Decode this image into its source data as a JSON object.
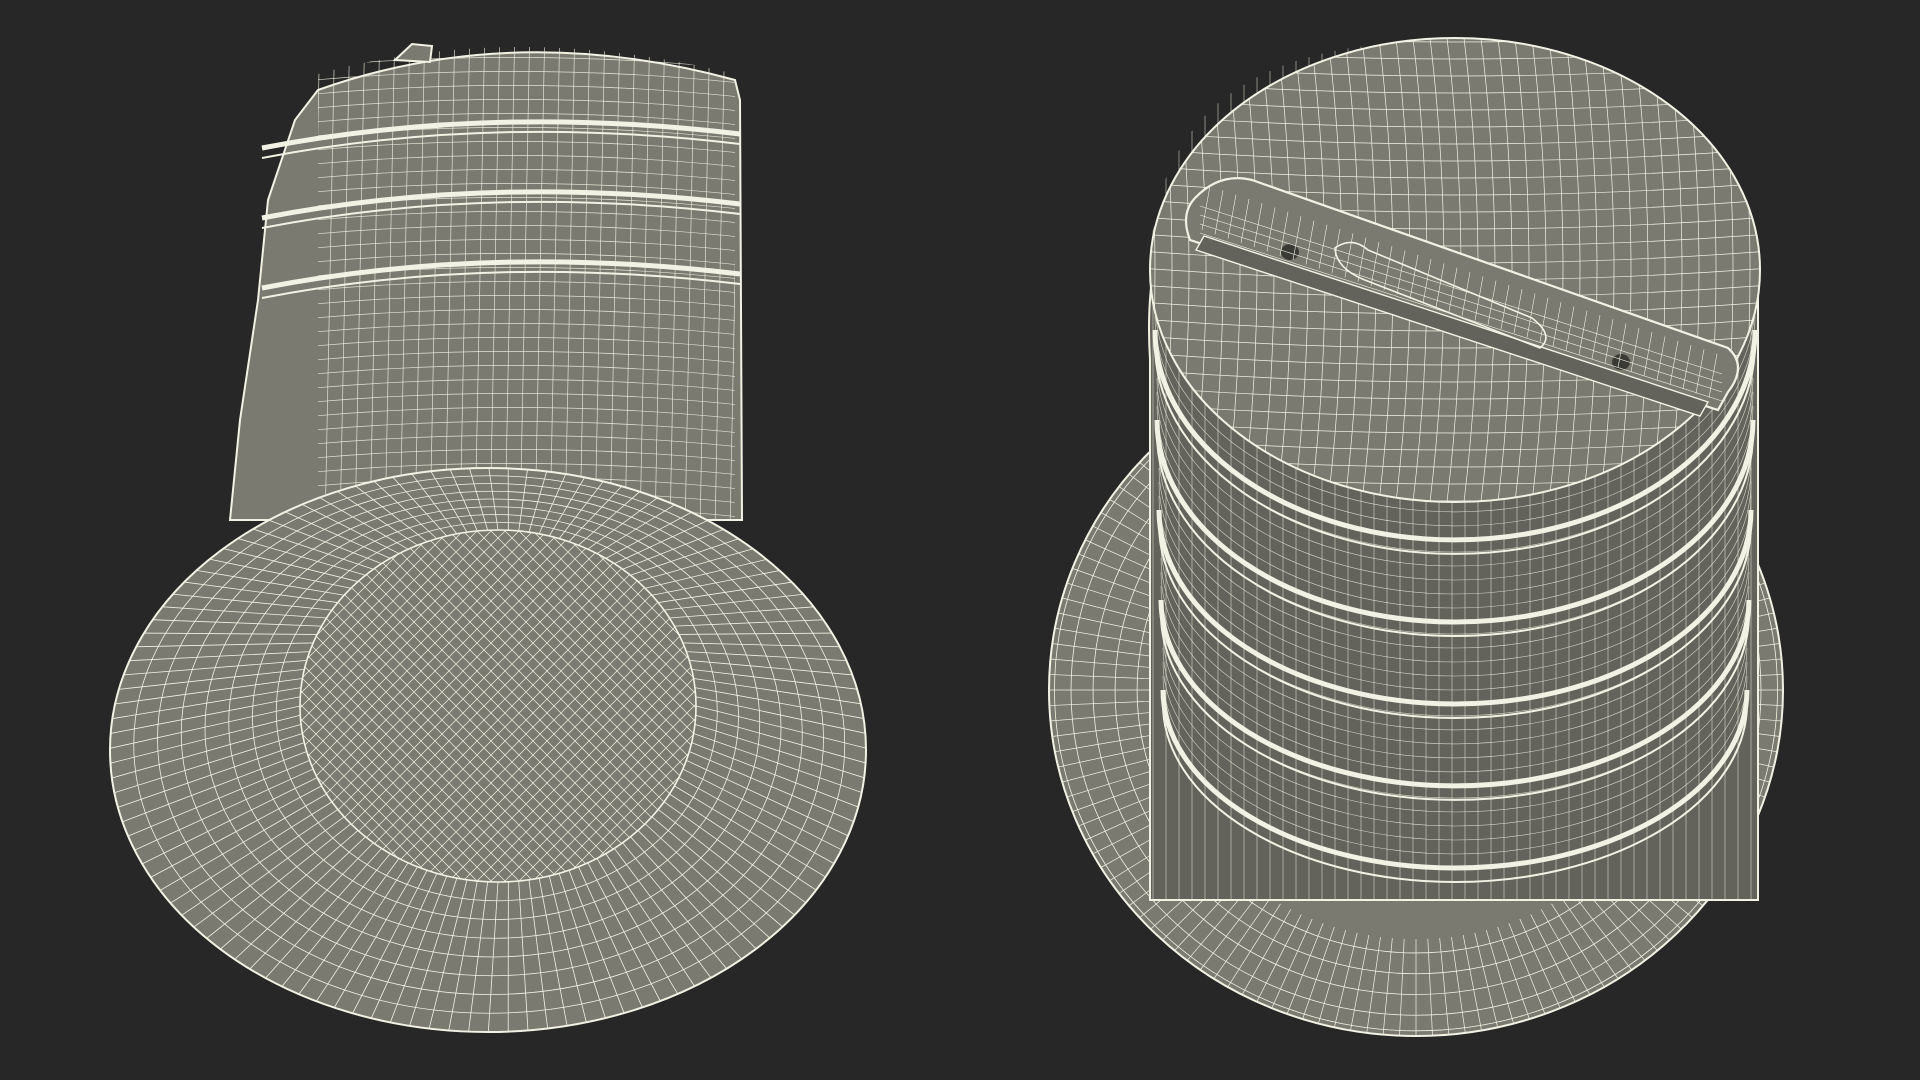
{
  "scene": {
    "background": "#272727",
    "mesh_fill": "#7a7a70",
    "mesh_fill_dark": "#63635b",
    "wire_color": "#f2f2e4",
    "models": [
      {
        "name": "bottom-view-model",
        "view": "underside"
      },
      {
        "name": "top-view-model",
        "view": "top"
      }
    ]
  }
}
